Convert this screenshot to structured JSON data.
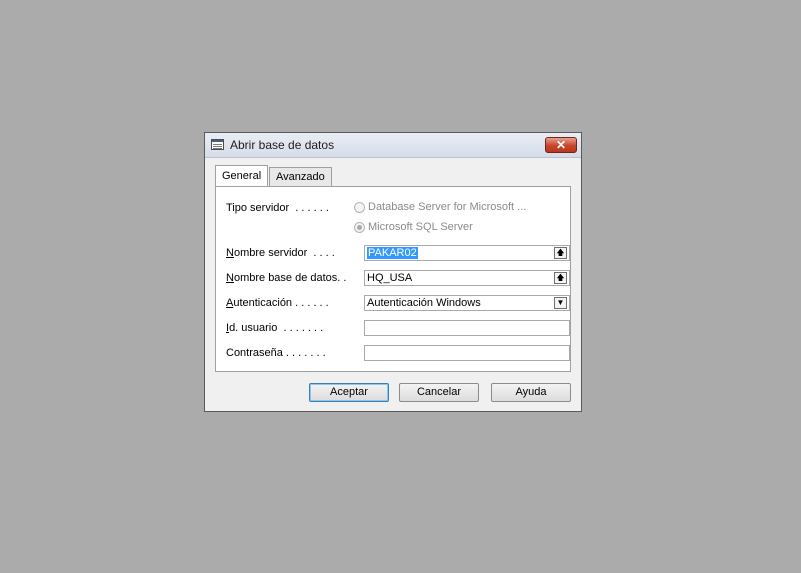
{
  "window": {
    "title": "Abrir base de datos",
    "close_glyph": "✕"
  },
  "tabs": [
    {
      "label": "General",
      "active": true
    },
    {
      "label": "Avanzado",
      "active": false
    }
  ],
  "form": {
    "server_type": {
      "label": "Tipo servidor  . . . . . .",
      "options": [
        {
          "label": "Database Server for Microsoft ...",
          "checked": false,
          "disabled": true
        },
        {
          "label": "Microsoft SQL Server",
          "checked": true,
          "disabled": true
        }
      ]
    },
    "server_name": {
      "label_u": "N",
      "label_rest": "ombre servidor  . . . .",
      "value": "PAKAR02"
    },
    "database_name": {
      "label_u": "N",
      "label_rest": "ombre base de datos. .",
      "value": "HQ_USA"
    },
    "authentication": {
      "label_u": "A",
      "label_rest": "utenticación . . . . . .",
      "value": "Autenticación Windows"
    },
    "user_id": {
      "label_u": "I",
      "label_rest": "d. usuario  . . . . . . .",
      "value": ""
    },
    "password": {
      "label_u": "",
      "label_rest": "Contraseña . . . . . . .",
      "value": ""
    }
  },
  "buttons": {
    "accept": "Aceptar",
    "cancel": "Cancelar",
    "help": "Ayuda"
  },
  "icons": {
    "lookup": "up-arrow-icon",
    "dropdown": "down-triangle-icon"
  }
}
